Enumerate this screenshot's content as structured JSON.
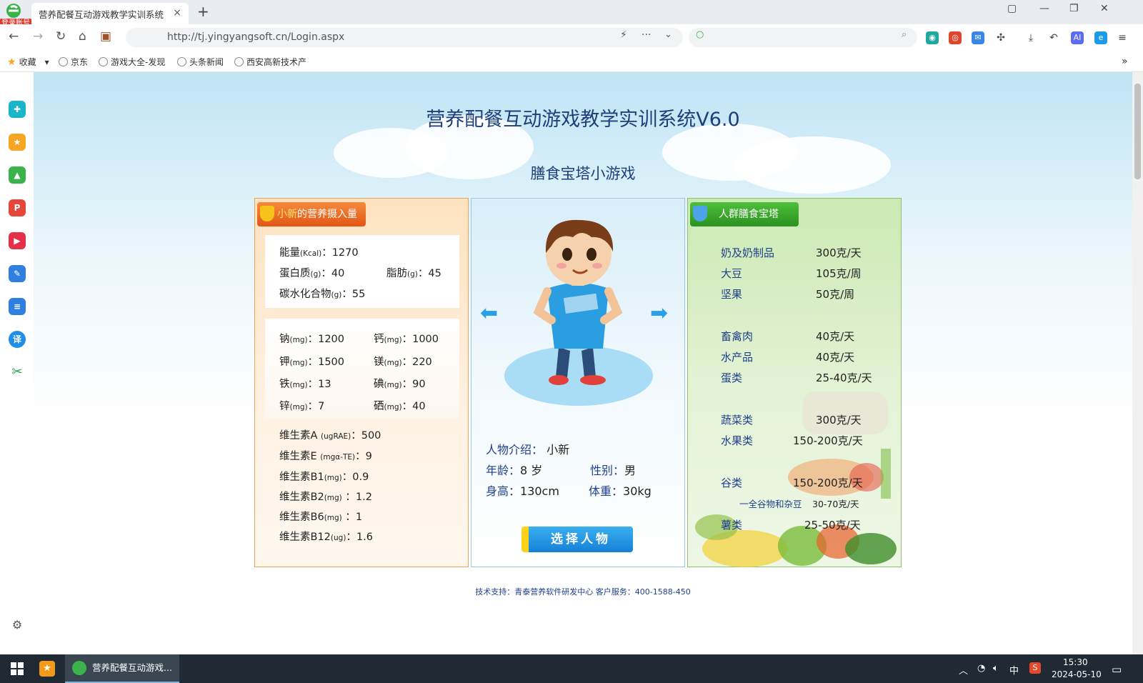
{
  "browser": {
    "badge": "登录账号",
    "tab_title": "营养配餐互动游戏教学实训系统",
    "tab_close": "×",
    "new_tab": "+",
    "url": "http://tj.yingyangsoft.cn/Login.aspx",
    "search_placeholder": ""
  },
  "bookmarks": {
    "favorites": "收藏",
    "items": [
      "京东",
      "游戏大全-发现",
      "头条新闻",
      "西安高新技术产"
    ]
  },
  "page": {
    "title": "营养配餐互动游戏教学实训系统V6.0",
    "subtitle": "膳食宝塔小游戏",
    "footer": "技术支持：青泰营养软件研发中心    客户服务：400-1588-450"
  },
  "intake_panel": {
    "header_name": "小新",
    "header_rest": "的营养摄入量",
    "energy_label": "能量",
    "energy_unit": "(Kcal)",
    "energy_value": "：1270",
    "protein_label": "蛋白质",
    "protein_unit": "(g)",
    "protein_value": "：40",
    "fat_label": "脂肪",
    "fat_unit": "(g)",
    "fat_value": "：45",
    "carb_label": "碳水化合物",
    "carb_unit": "(g)",
    "carb_value": "：55",
    "minerals": [
      {
        "label": "钠",
        "unit": "(mg)",
        "value": "：1200"
      },
      {
        "label": "钙",
        "unit": "(mg)",
        "value": "：1000"
      },
      {
        "label": "钾",
        "unit": "(mg)",
        "value": "：1500"
      },
      {
        "label": "镁",
        "unit": "(mg)",
        "value": "：220"
      },
      {
        "label": "铁",
        "unit": "(mg)",
        "value": "：13"
      },
      {
        "label": "碘",
        "unit": "(mg)",
        "value": "：90"
      },
      {
        "label": "锌",
        "unit": "(mg)",
        "value": "：7"
      },
      {
        "label": "硒",
        "unit": "(mg)",
        "value": "：40"
      }
    ],
    "vitamins": [
      {
        "label": "维生素A",
        "unit": "(ugRAE)",
        "value": "：500"
      },
      {
        "label": "维生素E",
        "unit": "(mgα-TE)",
        "value": "：9"
      },
      {
        "label": "维生素B1",
        "unit": "(mg)",
        "value": "：0.9"
      },
      {
        "label": "维生素B2",
        "unit": "(mg)",
        "value": "：1.2"
      },
      {
        "label": "维生素B6",
        "unit": "(mg)",
        "value": "：1"
      },
      {
        "label": "维生素B12",
        "unit": "(ug)",
        "value": "：1.6"
      }
    ]
  },
  "character_panel": {
    "intro_label": "人物介绍：",
    "intro_value": "小新",
    "age_label": "年龄：",
    "age_value": "8 岁",
    "gender_label": "性别：",
    "gender_value": "男",
    "height_label": "身高：",
    "height_value": "130cm",
    "weight_label": "体重：",
    "weight_value": "30kg",
    "select_button": "选择人物"
  },
  "pyramid_panel": {
    "header": "人群膳食宝塔",
    "rows": [
      {
        "label": "奶及奶制品",
        "value": "300克/天"
      },
      {
        "label": "大豆",
        "value": "105克/周"
      },
      {
        "label": "坚果",
        "value": "50克/周"
      },
      {
        "label": "畜禽肉",
        "value": "40克/天"
      },
      {
        "label": "水产品",
        "value": "40克/天"
      },
      {
        "label": "蛋类",
        "value": "25-40克/天"
      },
      {
        "label": "蔬菜类",
        "value": "300克/天"
      },
      {
        "label": "水果类",
        "value": "150-200克/天"
      },
      {
        "label": "谷类",
        "value": "150-200克/天"
      },
      {
        "label": "一全谷物和杂豆",
        "value": "30-70克/天"
      },
      {
        "label": "薯类",
        "value": "25-50克/天"
      }
    ]
  },
  "taskbar": {
    "app_label": "营养配餐互动游戏...",
    "ime": "中",
    "time": "15:30",
    "date": "2024-05-10"
  },
  "colors": {
    "title": "#1e3f7a",
    "orange_header": "#e25516",
    "green_header": "#2a9120",
    "select_button": "#1580d6"
  }
}
